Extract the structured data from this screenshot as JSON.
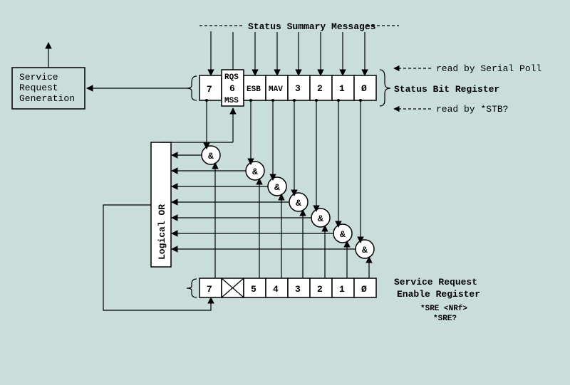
{
  "title": "Status Summary Messages",
  "service_request_box": "Service\nRequest\nGeneration",
  "logical_or_box": "Logical OR",
  "status_bit_register": {
    "cells": [
      "7",
      "RQS\n6\nMSS",
      "ESB",
      "MAV",
      "3",
      "2",
      "1",
      "0"
    ],
    "label": "Status Bit Register",
    "read_top": "read by Serial Poll",
    "read_bottom": "read by *STB?"
  },
  "enable_register": {
    "cells": [
      "7",
      "X",
      "5",
      "4",
      "3",
      "2",
      "1",
      "0"
    ],
    "label": "Service Request\nEnable Register",
    "cmd1": "*SRE <NRf>",
    "cmd2": "*SRE?"
  },
  "and_symbol": "&"
}
